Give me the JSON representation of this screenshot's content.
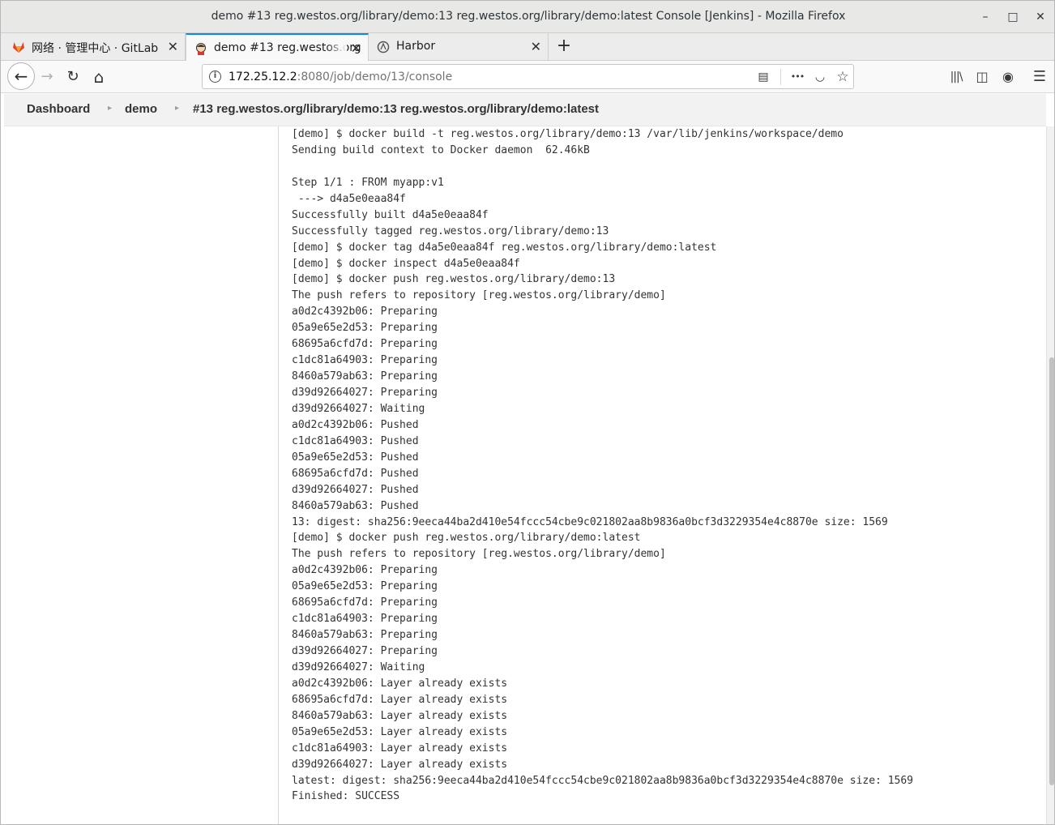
{
  "window": {
    "title": "demo #13 reg.westos.org/library/demo:13 reg.westos.org/library/demo:latest Console [Jenkins] - Mozilla Firefox",
    "minimize_glyph": "–",
    "maximize_glyph": "□",
    "close_glyph": "✕"
  },
  "tabs": [
    {
      "label": "网络 · 管理中心 · GitLab",
      "icon": "gitlab-icon",
      "active": false
    },
    {
      "label": "demo #13 reg.westos.org",
      "icon": "jenkins-icon",
      "active": true
    },
    {
      "label": "Harbor",
      "icon": "harbor-icon",
      "active": false
    }
  ],
  "tab_close_glyph": "✕",
  "new_tab_glyph": "+",
  "navbar": {
    "url_host": "172.25.12.2",
    "url_rest": ":8080/job/demo/13/console",
    "info_glyph": "i",
    "reader_glyph": "▤",
    "more_glyph": "•••",
    "pocket_glyph": "◡",
    "star_glyph": "☆",
    "library_glyph": "|||\\",
    "sidebar_glyph": "◫",
    "account_glyph": "◉",
    "menu_glyph": "☰",
    "back_glyph": "←",
    "forward_glyph": "→",
    "reload_glyph": "↻",
    "home_glyph": "⌂"
  },
  "breadcrumb": {
    "items": [
      "Dashboard",
      "demo",
      "#13 reg.westos.org/library/demo:13 reg.westos.org/library/demo:latest"
    ],
    "separator": "▸"
  },
  "console": {
    "lines": [
      "[demo] $ docker build -t reg.westos.org/library/demo:13 /var/lib/jenkins/workspace/demo",
      "Sending build context to Docker daemon  62.46kB",
      "",
      "Step 1/1 : FROM myapp:v1",
      " ---> d4a5e0eaa84f",
      "Successfully built d4a5e0eaa84f",
      "Successfully tagged reg.westos.org/library/demo:13",
      "[demo] $ docker tag d4a5e0eaa84f reg.westos.org/library/demo:latest",
      "[demo] $ docker inspect d4a5e0eaa84f",
      "[demo] $ docker push reg.westos.org/library/demo:13",
      "The push refers to repository [reg.westos.org/library/demo]",
      "a0d2c4392b06: Preparing",
      "05a9e65e2d53: Preparing",
      "68695a6cfd7d: Preparing",
      "c1dc81a64903: Preparing",
      "8460a579ab63: Preparing",
      "d39d92664027: Preparing",
      "d39d92664027: Waiting",
      "a0d2c4392b06: Pushed",
      "c1dc81a64903: Pushed",
      "05a9e65e2d53: Pushed",
      "68695a6cfd7d: Pushed",
      "d39d92664027: Pushed",
      "8460a579ab63: Pushed",
      "13: digest: sha256:9eeca44ba2d410e54fccc54cbe9c021802aa8b9836a0bcf3d3229354e4c8870e size: 1569",
      "[demo] $ docker push reg.westos.org/library/demo:latest",
      "The push refers to repository [reg.westos.org/library/demo]",
      "a0d2c4392b06: Preparing",
      "05a9e65e2d53: Preparing",
      "68695a6cfd7d: Preparing",
      "c1dc81a64903: Preparing",
      "8460a579ab63: Preparing",
      "d39d92664027: Preparing",
      "d39d92664027: Waiting",
      "a0d2c4392b06: Layer already exists",
      "68695a6cfd7d: Layer already exists",
      "8460a579ab63: Layer already exists",
      "05a9e65e2d53: Layer already exists",
      "c1dc81a64903: Layer already exists",
      "d39d92664027: Layer already exists",
      "latest: digest: sha256:9eeca44ba2d410e54fccc54cbe9c021802aa8b9836a0bcf3d3229354e4c8870e size: 1569",
      "Finished: SUCCESS"
    ]
  },
  "colors": {
    "accent_tab": "#0a84ff",
    "gitlab_orange": "#e24329",
    "console_text": "#333333"
  }
}
